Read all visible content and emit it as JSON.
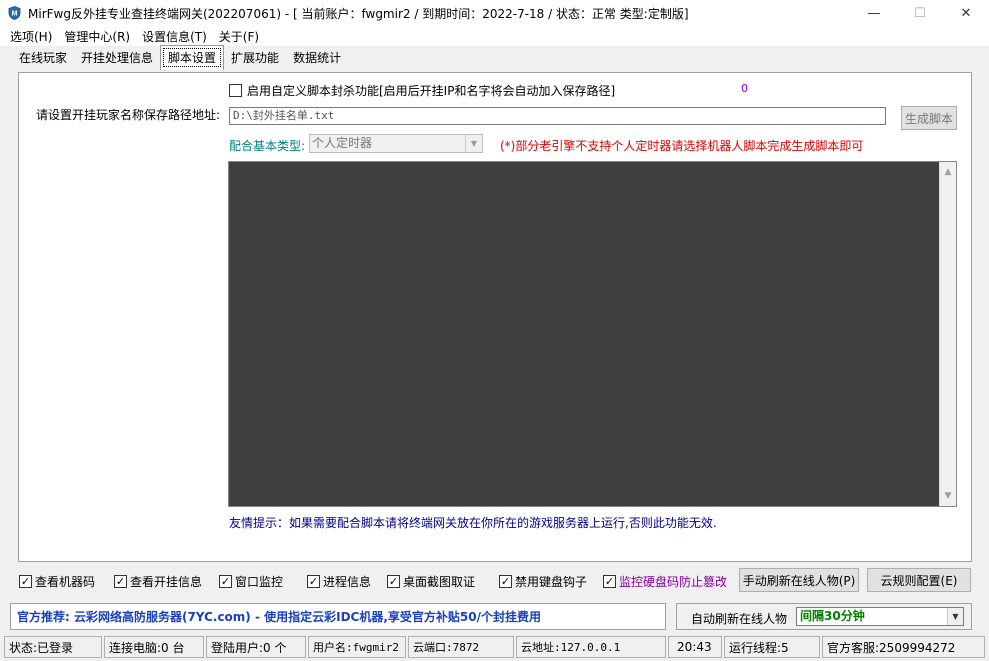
{
  "window": {
    "title": "MirFwg反外挂专业查挂终端网关(202207061)  - [ 当前账户：fwgmir2 / 到期时间：2022-7-18 / 状态：正常  类型:定制版]",
    "min_glyph": "—",
    "max_glyph": "☐",
    "close_glyph": "✕"
  },
  "menu": [
    {
      "label": "选项(H)"
    },
    {
      "label": "管理中心(R)"
    },
    {
      "label": "设置信息(T)"
    },
    {
      "label": "关于(F)"
    }
  ],
  "tabs": [
    {
      "label": "在线玩家"
    },
    {
      "label": "开挂处理信息"
    },
    {
      "label": "脚本设置"
    },
    {
      "label": "扩展功能"
    },
    {
      "label": "数据统计"
    }
  ],
  "active_tab_index": 2,
  "script": {
    "enable_label": "启用自定义脚本封杀功能[启用后开挂IP和名字将会自动加入保存路径]",
    "enable_checked": false,
    "counter": "0",
    "path_label": "请设置开挂玩家名称保存路径地址:",
    "path_value": "D:\\封外挂名单.txt",
    "generate_button": "生成脚本",
    "type_label": "配合基本类型:",
    "type_value": "个人定时器",
    "warning": "(*)部分老引擎不支持个人定时器请选择机器人脚本完成生成脚本即可",
    "tip": "友情提示：如果需要配合脚本请将终端网关放在你所在的游戏服务器上运行,否则此功能无效."
  },
  "checks": [
    {
      "label": "查看机器码",
      "checked": true
    },
    {
      "label": "查看开挂信息",
      "checked": true
    },
    {
      "label": "窗口监控",
      "checked": true
    },
    {
      "label": "进程信息",
      "checked": true
    },
    {
      "label": "桌面截图取证",
      "checked": true
    },
    {
      "label": "禁用键盘钩子",
      "checked": true
    },
    {
      "label": "监控硬盘码防止篡改",
      "checked": true
    }
  ],
  "check_glyph": "✓",
  "buttons": {
    "refresh_online": "手动刷新在线人物(P)",
    "cloud_rules": "云规则配置(E)"
  },
  "promo": "官方推荐: 云彩网络高防服务器(7YC.com) - 使用指定云彩IDC机器,享受官方补贴50/个封挂费用",
  "auto_refresh": {
    "label": "自动刷新在线人物",
    "value": "间隔30分钟"
  },
  "status": {
    "state": "状态:已登录",
    "connected_pcs": "连接电脑:0 台",
    "logged_users": "登陆用户:0 个",
    "username": "用户名:fwgmir2",
    "cloud_port": "云端口:7872",
    "cloud_address": "云地址:127.0.0.1",
    "time": "20:43",
    "threads": "运行线程:5",
    "support": "官方客服:2509994272"
  },
  "colors": {
    "editor_bg": "#404040",
    "warning": "#e00000",
    "tip": "#00008b",
    "promo": "#1a3fbf",
    "type_label": "#008080",
    "counter": "#8000ff",
    "interval": "#008000"
  }
}
